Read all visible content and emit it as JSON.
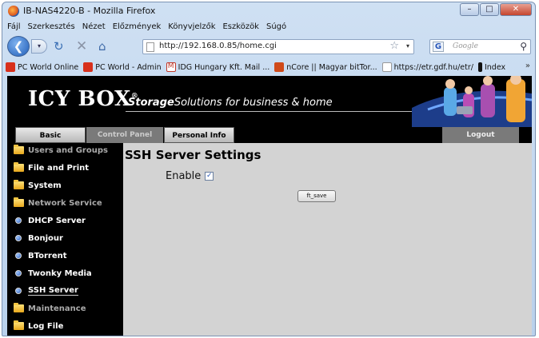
{
  "window": {
    "title": "IB-NAS4220-B - Mozilla Firefox"
  },
  "menu": [
    "Fájl",
    "Szerkesztés",
    "Nézet",
    "Előzmények",
    "Könyvjelzők",
    "Eszközök",
    "Súgó"
  ],
  "address": {
    "url": "http://192.168.0.85/home.cgi",
    "search_placeholder": "Google"
  },
  "bookmarks": [
    {
      "label": "PC World Online",
      "color": "#d8301c"
    },
    {
      "label": "PC World - Admin",
      "color": "#d8301c"
    },
    {
      "label": "IDG Hungary Kft. Mail ...",
      "color": "#c0392b"
    },
    {
      "label": "nCore || Magyar bitTor...",
      "color": "#d04a1a"
    },
    {
      "label": "https://etr.gdf.hu/etr/",
      "color": "#ffffff"
    },
    {
      "label": "Index",
      "color": "#111111"
    }
  ],
  "banner": {
    "logo": "ICY BOX",
    "reg": "®",
    "tagline_bold": "Storage",
    "tagline_rest": "Solutions for business & home"
  },
  "tabs": {
    "basic": "Basic",
    "control_panel": "Control Panel",
    "personal_info": "Personal Info",
    "logout": "Logout"
  },
  "sidebar": [
    {
      "label": "Users and Groups",
      "kind": "folder",
      "dim": true
    },
    {
      "label": "File and Print",
      "kind": "folder",
      "dim": false
    },
    {
      "label": "System",
      "kind": "folder",
      "dim": false
    },
    {
      "label": "Network Service",
      "kind": "folder",
      "dim": true
    },
    {
      "label": "DHCP Server",
      "kind": "bullet",
      "dim": false
    },
    {
      "label": "Bonjour",
      "kind": "bullet",
      "dim": false
    },
    {
      "label": "BTorrent",
      "kind": "bullet",
      "dim": false
    },
    {
      "label": "Twonky Media",
      "kind": "bullet",
      "dim": false
    },
    {
      "label": "SSH Server",
      "kind": "bullet",
      "dim": false,
      "active": true
    },
    {
      "label": "Maintenance",
      "kind": "folder",
      "dim": true
    },
    {
      "label": "Log File",
      "kind": "folder",
      "dim": false
    }
  ],
  "content": {
    "title": "SSH Server Settings",
    "enable_label": "Enable",
    "enable_checked": true,
    "save_label": "ft_save"
  }
}
